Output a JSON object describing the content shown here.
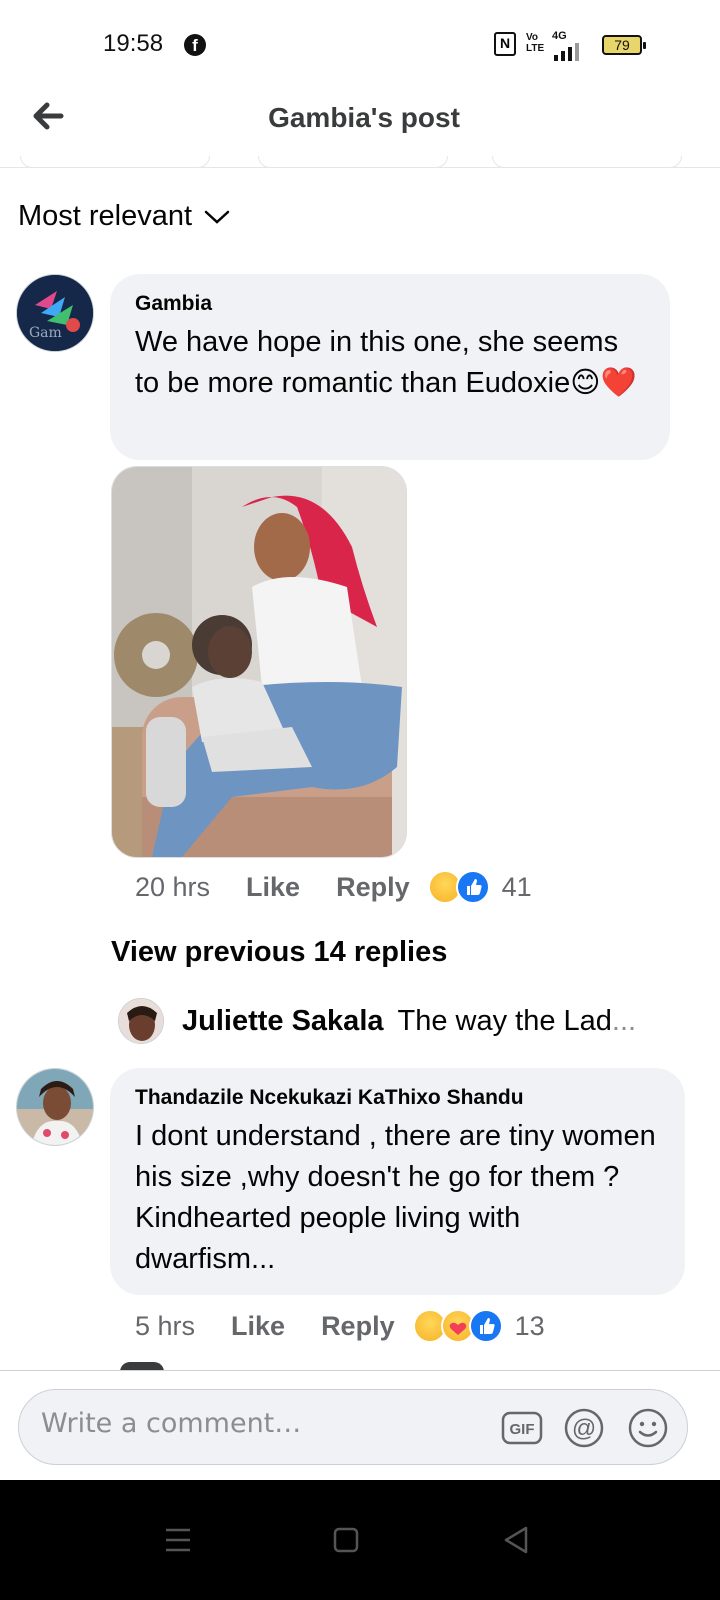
{
  "status_bar": {
    "time": "19:58",
    "network": "4G",
    "volte": "Vo LTE",
    "battery": "79"
  },
  "header": {
    "title": "Gambia's post"
  },
  "sort": {
    "label": "Most relevant"
  },
  "comments": [
    {
      "author": "Gambia",
      "text": "We have hope in this one, she seems to be more romantic than Eudoxie😊❤️",
      "time": "20 hrs",
      "like_label": "Like",
      "reply_label": "Reply",
      "reaction_count": "41",
      "reactions": [
        "laughing",
        "like"
      ]
    },
    {
      "author": "Thandazile Ncekukazi KaThixo Shandu",
      "text": "I dont understand , there are tiny women his size ,why doesn't he go for them ? Kindhearted people living with dwarfism...",
      "time": "5 hrs",
      "like_label": "Like",
      "reply_label": "Reply",
      "reaction_count": "13",
      "reactions": [
        "laughing",
        "care",
        "like"
      ]
    }
  ],
  "view_previous": "View previous 14 replies",
  "reply_preview": {
    "author": "Juliette Sakala",
    "text": "The way the Lad"
  },
  "composer": {
    "placeholder": "Write a comment…"
  },
  "colors": {
    "bubble": "#f0f2f5",
    "like_blue": "#1877f2",
    "meta_gray": "#65676b",
    "nav_bar": "#000000"
  }
}
